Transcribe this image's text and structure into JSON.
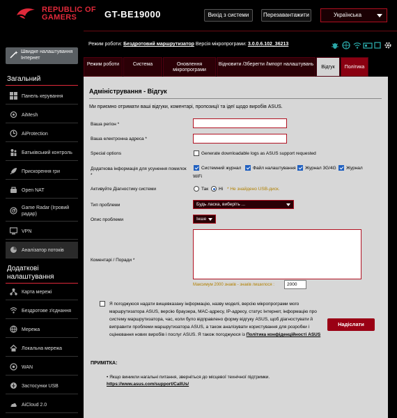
{
  "header": {
    "brand_line1": "REPUBLIC OF",
    "brand_line2": "GAMERS",
    "model": "GT-BE19000",
    "logout_label": "Вихід з системи",
    "reboot_label": "Перезавантажити",
    "language": "Українська"
  },
  "status": {
    "mode_label": "Режим роботи:",
    "mode_value": "Бездротовий маршрутизатор",
    "firmware_label": "Версія мікропрограми:",
    "firmware_value": "3.0.0.6.102_36213"
  },
  "sidebar": {
    "quick_setup": "Швидке налаштування Інтернет",
    "section_general": "Загальний",
    "general_items": [
      {
        "label": "Панель керування",
        "icon": "dashboard-icon"
      },
      {
        "label": "AiMesh",
        "icon": "mesh-icon"
      },
      {
        "label": "AiProtection",
        "icon": "shield-icon"
      },
      {
        "label": "Батьківський контроль",
        "icon": "parental-icon"
      },
      {
        "label": "Прискорення гри",
        "icon": "rocket-icon"
      },
      {
        "label": "Open NAT",
        "icon": "nat-icon"
      },
      {
        "label": "Game Radar (Ігровий радар)",
        "icon": "radar-icon"
      },
      {
        "label": "VPN",
        "icon": "vpn-icon"
      },
      {
        "label": "Аналізатор потоків",
        "icon": "analyzer-icon"
      }
    ],
    "section_advanced": "Додаткові налаштування",
    "advanced_items": [
      {
        "label": "Карта мережі",
        "icon": "map-icon"
      },
      {
        "label": "Бездротове з'єднання",
        "icon": "wifi-icon"
      },
      {
        "label": "Мережа",
        "icon": "network-icon"
      },
      {
        "label": "Локальна мережа",
        "icon": "home-icon"
      },
      {
        "label": "WAN",
        "icon": "globe-icon"
      },
      {
        "label": "Застосунки USB",
        "icon": "usb-icon"
      },
      {
        "label": "AiCloud 2.0",
        "icon": "cloud-icon"
      }
    ]
  },
  "tabs": [
    "Режим роботи",
    "Система",
    "Оновлення мікропрограми",
    "Відновити /Зберегти /Імпорт налаштувань",
    "Відгук",
    "Політика"
  ],
  "form": {
    "title": "Адміністрування - Відгук",
    "description": "Ми приємно отримати ваші відгуки, коментарі, пропозиції та ідеї щодо виробів ASUS.",
    "region_label": "Ваша регіон *",
    "email_label": "Ваша електронна адреса *",
    "special_label": "Special options",
    "special_option": "Generate downloadable logs as ASUS support requested",
    "extra_label": "Додаткова інформація для усунення помилок *",
    "extra_options": [
      "Системний журнал",
      "Файл налаштування",
      "Журнал 3G/4G",
      "Журнал",
      "WiFi"
    ],
    "diag_label": "Активуйте Діагностику системи",
    "diag_yes": "Так",
    "diag_no": "Ні",
    "diag_note": "* Не знайдено USB-диск.",
    "problem_type_label": "Тип проблеми",
    "problem_type_value": "Будь ласка, виберіть ...",
    "problem_desc_label": "Опис проблеми",
    "problem_desc_value": "Інше",
    "comment_label": "Коментарі / Поради *",
    "max_chars": "Максимум 2000 знаків - знаків лишилося :",
    "chars_left": "2000",
    "agree_text": "Я погоджуюся надати вищевказану інформацію, назву моделі, версію мікропрограми мого маршрутизатора ASUS, версію браузера, MAC-адресу, IP-адресу, статус Інтернет, інформацію про систему маршрутизатора, час, коли було відправлено форму відгуку ASUS, щоб діагностувати й виправити проблеми маршрутизатора ASUS, а також аналізувати користування для розробки і оцінювання нових виробів і послуг ASUS. Я також погоджуюся із",
    "policy_link": "Політика конфіденційності ASUS",
    "submit_label": "Надіслати",
    "note_title": "ПРИМІТКА:",
    "note_text": "Якщо виникли нагальні питання, зверніться до місцевої технічної підтримки.",
    "note_link": "https://www.asus.com/support/CallUs/"
  },
  "colors": {
    "accent": "#e0293a",
    "tab_bg": "#2b0006",
    "content_bg": "#d7d7d7"
  }
}
